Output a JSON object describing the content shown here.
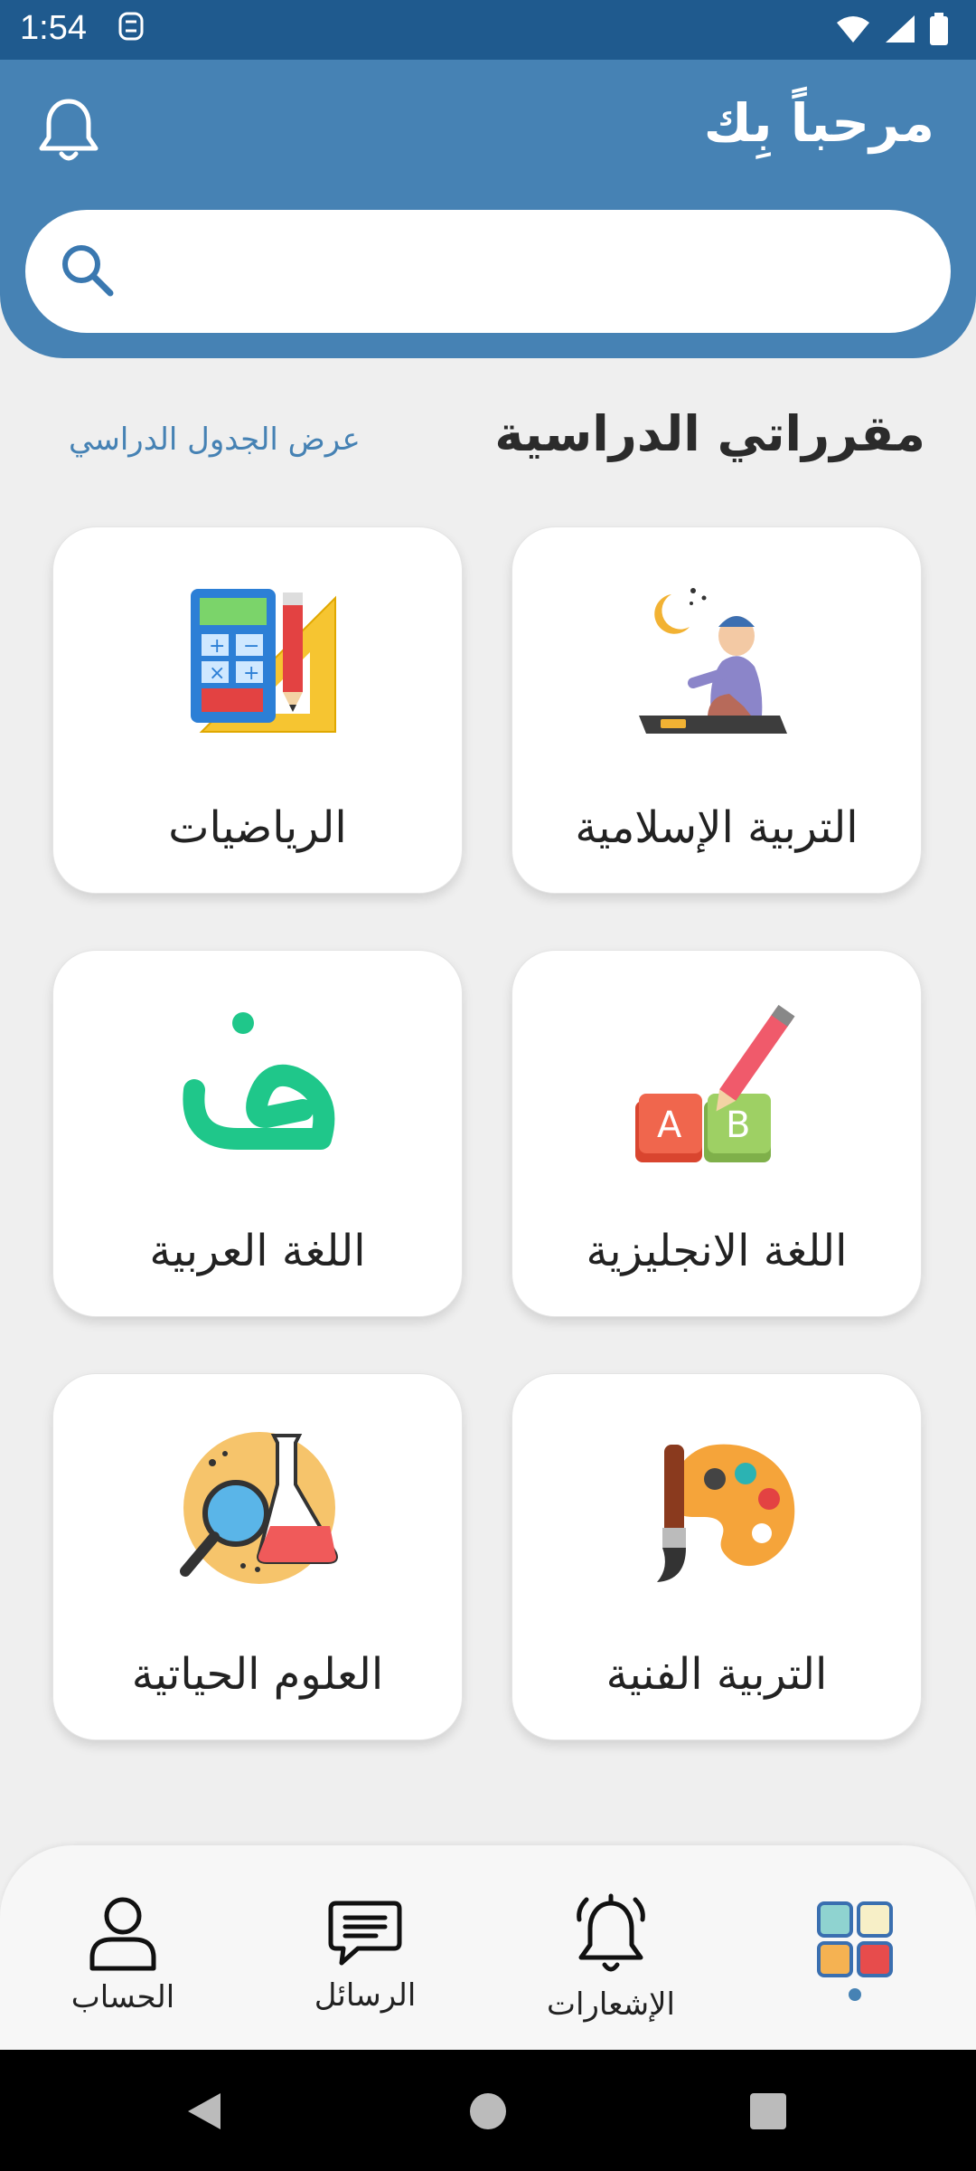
{
  "status_bar": {
    "time": "1:54"
  },
  "header": {
    "greeting": "مرحباً بِك",
    "search_placeholder": ""
  },
  "section": {
    "title": "مقرراتي الدراسية",
    "schedule_link": "عرض الجدول الدراسي"
  },
  "courses": [
    {
      "label": "التربية الإسلامية",
      "icon": "prayer-icon"
    },
    {
      "label": "الرياضيات",
      "icon": "calculator-ruler-icon"
    },
    {
      "label": "اللغة الانجليزية",
      "icon": "abc-blocks-pencil-icon"
    },
    {
      "label": "اللغة العربية",
      "icon": "arabic-letter-icon"
    },
    {
      "label": "التربية الفنية",
      "icon": "paint-palette-icon"
    },
    {
      "label": "العلوم الحياتية",
      "icon": "science-flask-icon"
    }
  ],
  "bottom_nav": {
    "home_icon": "grid-icon",
    "notifications": "الإشعارات",
    "messages": "الرسائل",
    "account": "الحساب"
  },
  "colors": {
    "primary": "#4682b4",
    "status_bar": "#1f5a8e",
    "background": "#efefef"
  }
}
